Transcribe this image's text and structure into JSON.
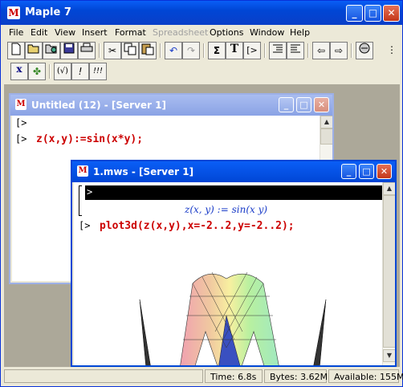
{
  "app": {
    "title": "Maple 7"
  },
  "menu": [
    {
      "label": "File",
      "disabled": false
    },
    {
      "label": "Edit",
      "disabled": false
    },
    {
      "label": "View",
      "disabled": false
    },
    {
      "label": "Insert",
      "disabled": false
    },
    {
      "label": "Format",
      "disabled": false
    },
    {
      "label": "Spreadsheet",
      "disabled": true
    },
    {
      "label": "Options",
      "disabled": false
    },
    {
      "label": "Window",
      "disabled": false
    },
    {
      "label": "Help",
      "disabled": false
    }
  ],
  "toolbar_glyphs": {
    "sigma": "Σ",
    "text_t": "T",
    "prompt_btn": "[>",
    "x_btn": "x",
    "maple_leaf": "✤",
    "sqrt_btn": "(√)",
    "bang": "!",
    "triple_bang": "!!!"
  },
  "window_untitled": {
    "title": "Untitled (12) - [Server 1]",
    "prompt1": "[>",
    "prompt2": "[>",
    "command": "z(x,y):=sin(x*y);"
  },
  "window_mws": {
    "title": "1.mws - [Server 1]",
    "prompt_top": ">",
    "output": "z(x, y) := sin(x y)",
    "prompt": "[>",
    "command": "plot3d(z(x,y),x=-2..2,y=-2..2);"
  },
  "status": {
    "time": "Time:  6.8s",
    "bytes": "Bytes: 3.62M",
    "available": "Available: 155M"
  }
}
